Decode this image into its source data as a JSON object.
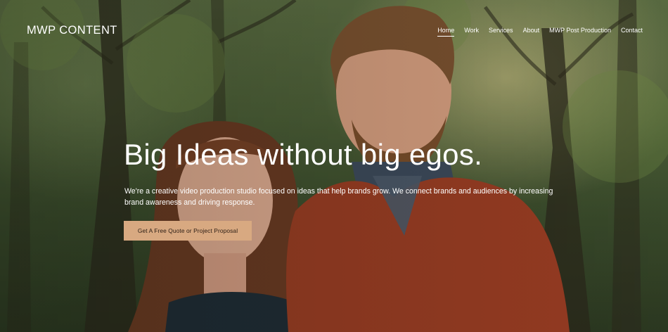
{
  "brand": {
    "logo_text": "MWP CONTENT"
  },
  "nav": {
    "items": [
      {
        "label": "Home",
        "active": true
      },
      {
        "label": "Work",
        "active": false
      },
      {
        "label": "Services",
        "active": false
      },
      {
        "label": "About",
        "active": false
      },
      {
        "label": "MWP Post Production",
        "active": false
      },
      {
        "label": "Contact",
        "active": false
      }
    ]
  },
  "hero": {
    "headline": "Big Ideas without big egos.",
    "subcopy": "We're a creative video production studio focused on ideas that help brands grow. We connect brands and audiences by increasing brand awareness and driving response.",
    "cta_label": "Get A Free Quote or Project Proposal"
  },
  "colors": {
    "cta_background": "#d8a981",
    "cta_text": "#2b1d14",
    "text": "#ffffff"
  }
}
